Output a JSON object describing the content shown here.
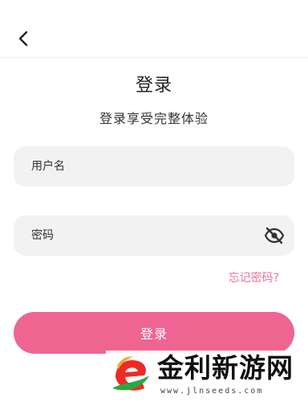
{
  "header": {
    "back_icon": "chevron-left-icon"
  },
  "login": {
    "title": "登录",
    "subtitle": "登录享受完整体验",
    "username_placeholder": "用户名",
    "password_placeholder": "密码",
    "password_toggle_icon": "eye-off-icon",
    "forgot_password": "忘记密码?",
    "submit_label": "登录"
  },
  "colors": {
    "accent": "#ee6592",
    "link": "#e8739b",
    "field_bg": "#f2f2f2"
  },
  "watermark": {
    "name": "金利新游网",
    "url": "www.jlnseeds.com"
  }
}
